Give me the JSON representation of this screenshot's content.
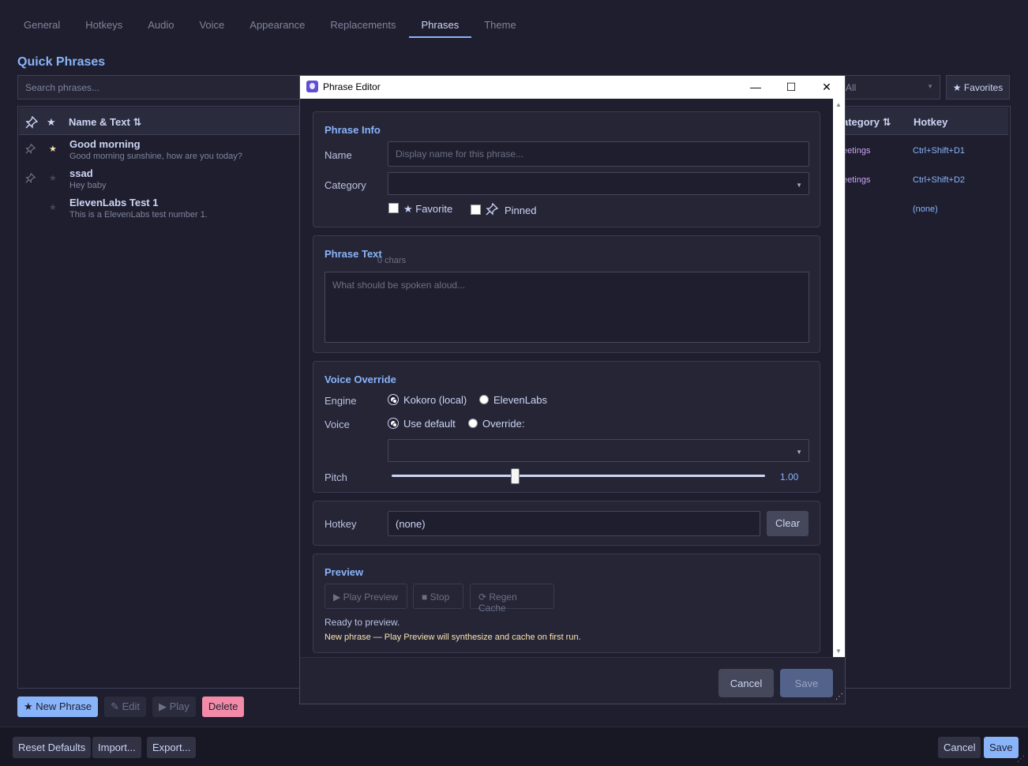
{
  "tabs": [
    "General",
    "Hotkeys",
    "Audio",
    "Voice",
    "Appearance",
    "Replacements",
    "Phrases",
    "Theme"
  ],
  "active_tab": "Phrases",
  "heading": "Quick Phrases",
  "search": {
    "placeholder": "Search phrases..."
  },
  "category_filter": {
    "value": "All"
  },
  "favorites_button": "★ Favorites",
  "table": {
    "headers": {
      "pin": "📌",
      "star": "★",
      "name": "Name & Text  ⇅",
      "category": "ategory  ⇅",
      "hotkey": "Hotkey"
    },
    "rows": [
      {
        "name": "Good morning",
        "text": "Good morning sunshine, how are you today?",
        "category": "eetings",
        "hotkey": "Ctrl+Shift+D1",
        "favorite": true,
        "pinned": true
      },
      {
        "name": "ssad",
        "text": "Hey baby",
        "category": "eetings",
        "hotkey": "Ctrl+Shift+D2",
        "favorite": false,
        "pinned": true
      },
      {
        "name": "ElevenLabs Test 1",
        "text": "This is a ElevenLabs test number 1.",
        "category": "",
        "hotkey": "(none)",
        "favorite": false,
        "pinned": false
      }
    ]
  },
  "actions": {
    "new": "★ New Phrase",
    "edit": "✎ Edit",
    "play": "▶ Play",
    "delete": "Delete"
  },
  "footer": {
    "reset": "Reset Defaults",
    "import": "Import...",
    "export": "Export...",
    "cancel": "Cancel",
    "save": "Save"
  },
  "dialog": {
    "title": "Phrase Editor",
    "window_buttons": {
      "minimize": "—",
      "maximize": "☐",
      "close": "✕"
    },
    "info": {
      "title": "Phrase Info",
      "name_label": "Name",
      "name_placeholder": "Display name for this phrase...",
      "category_label": "Category",
      "category_value": "",
      "favorite_label": "★  Favorite",
      "pinned_label": "Pinned"
    },
    "text": {
      "title": "Phrase Text",
      "count": "0  chars",
      "placeholder": "What should be spoken aloud..."
    },
    "voice": {
      "title": "Voice Override",
      "engine_label": "Engine",
      "engine_options": [
        "Kokoro (local)",
        "ElevenLabs"
      ],
      "engine_selected": "Kokoro (local)",
      "voice_label": "Voice",
      "voice_options": [
        "Use default",
        "Override:"
      ],
      "voice_selected": "Use default",
      "voice_value": "",
      "pitch_label": "Pitch",
      "pitch_value": "1.00",
      "pitch_fraction": 0.33
    },
    "hotkey": {
      "label": "Hotkey",
      "value": "(none)",
      "clear": "Clear"
    },
    "preview": {
      "title": "Preview",
      "play": "▶  Play Preview",
      "stop": "■  Stop",
      "regen": "⟳  Regen Cache",
      "status": "Ready to preview.",
      "note": "New phrase — Play Preview will synthesize and cache on first run."
    },
    "buttons": {
      "cancel": "Cancel",
      "save": "Save"
    }
  },
  "colors": {
    "accent": "#89b4fa",
    "background": "#1e1e2e",
    "danger": "#f38ba8",
    "favorite": "#f9e2af",
    "category": "#cba6f7",
    "note": "#f9e2af"
  }
}
